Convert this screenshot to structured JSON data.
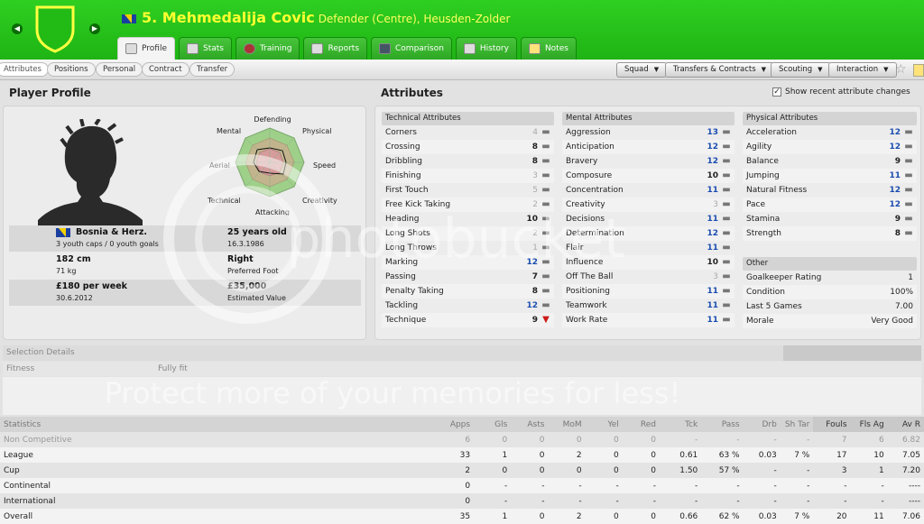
{
  "header": {
    "number": "5.",
    "name": "Mehmedalija Covic",
    "subtitle": "Defender (Centre), Heusden-Zolder",
    "colors": {
      "bar": "#2fcf21",
      "title": "#ffff30"
    },
    "prev_icon": "chevron-left-icon",
    "next_icon": "chevron-right-icon",
    "tabs": [
      {
        "label": "Profile",
        "active": true,
        "icon": "profile-icon"
      },
      {
        "label": "Stats",
        "icon": "stats-icon"
      },
      {
        "label": "Training",
        "icon": "training-icon"
      },
      {
        "label": "Reports",
        "icon": "reports-icon"
      },
      {
        "label": "Comparison",
        "icon": "comparison-icon"
      },
      {
        "label": "History",
        "icon": "history-icon"
      },
      {
        "label": "Notes",
        "icon": "notes-icon"
      }
    ]
  },
  "subbar": {
    "tabs": [
      "Attributes",
      "Positions",
      "Personal",
      "Contract",
      "Transfer"
    ],
    "menus": [
      "Squad",
      "Transfers & Contracts",
      "Scouting",
      "Interaction"
    ]
  },
  "profile": {
    "heading": "Player Profile",
    "radar_labels": [
      "Defending",
      "Physical",
      "Speed",
      "Creativity",
      "Attacking",
      "Technical",
      "Aerial",
      "Mental"
    ],
    "nationality": "Bosnia & Herz.",
    "caps": "3 youth caps / 0 youth goals",
    "age": "25 years old",
    "dob": "16.3.1986",
    "height": "182 cm",
    "weight": "71 kg",
    "foot": "Right",
    "foot_label": "Preferred Foot",
    "wage": "£180 per week",
    "contract": "30.6.2012",
    "value": "£35,000",
    "value_label": "Estimated Value"
  },
  "attributes": {
    "heading": "Attributes",
    "show_changes_label": "Show recent attribute changes",
    "show_changes_checked": true,
    "technical": {
      "title": "Technical Attributes",
      "rows": [
        {
          "name": "Corners",
          "value": "4",
          "style": "grey",
          "change": "none"
        },
        {
          "name": "Crossing",
          "value": "8",
          "style": "",
          "change": "none"
        },
        {
          "name": "Dribbling",
          "value": "8",
          "style": "",
          "change": "none"
        },
        {
          "name": "Finishing",
          "value": "3",
          "style": "grey",
          "change": "none"
        },
        {
          "name": "First Touch",
          "value": "5",
          "style": "grey",
          "change": "none"
        },
        {
          "name": "Free Kick Taking",
          "value": "2",
          "style": "grey",
          "change": "none"
        },
        {
          "name": "Heading",
          "value": "10",
          "style": "",
          "change": "none"
        },
        {
          "name": "Long Shots",
          "value": "2",
          "style": "grey",
          "change": "none"
        },
        {
          "name": "Long Throws",
          "value": "1",
          "style": "grey",
          "change": "none"
        },
        {
          "name": "Marking",
          "value": "12",
          "style": "blue",
          "change": "none"
        },
        {
          "name": "Passing",
          "value": "7",
          "style": "",
          "change": "none"
        },
        {
          "name": "Penalty Taking",
          "value": "8",
          "style": "",
          "change": "none"
        },
        {
          "name": "Tackling",
          "value": "12",
          "style": "blue",
          "change": "none"
        },
        {
          "name": "Technique",
          "value": "9",
          "style": "",
          "change": "down"
        }
      ]
    },
    "mental": {
      "title": "Mental Attributes",
      "rows": [
        {
          "name": "Aggression",
          "value": "13",
          "style": "blue",
          "change": "none"
        },
        {
          "name": "Anticipation",
          "value": "12",
          "style": "blue",
          "change": "none"
        },
        {
          "name": "Bravery",
          "value": "12",
          "style": "blue",
          "change": "none"
        },
        {
          "name": "Composure",
          "value": "10",
          "style": "",
          "change": "none"
        },
        {
          "name": "Concentration",
          "value": "11",
          "style": "blue",
          "change": "none"
        },
        {
          "name": "Creativity",
          "value": "3",
          "style": "grey",
          "change": "none"
        },
        {
          "name": "Decisions",
          "value": "11",
          "style": "blue",
          "change": "none"
        },
        {
          "name": "Determination",
          "value": "12",
          "style": "blue",
          "change": "none"
        },
        {
          "name": "Flair",
          "value": "11",
          "style": "blue",
          "change": "none"
        },
        {
          "name": "Influence",
          "value": "10",
          "style": "",
          "change": "none"
        },
        {
          "name": "Off The Ball",
          "value": "3",
          "style": "grey",
          "change": "none"
        },
        {
          "name": "Positioning",
          "value": "11",
          "style": "blue",
          "change": "none"
        },
        {
          "name": "Teamwork",
          "value": "11",
          "style": "blue",
          "change": "none"
        },
        {
          "name": "Work Rate",
          "value": "11",
          "style": "blue",
          "change": "none"
        }
      ]
    },
    "physical": {
      "title": "Physical Attributes",
      "rows": [
        {
          "name": "Acceleration",
          "value": "12",
          "style": "blue",
          "change": "none"
        },
        {
          "name": "Agility",
          "value": "12",
          "style": "blue",
          "change": "none"
        },
        {
          "name": "Balance",
          "value": "9",
          "style": "",
          "change": "none"
        },
        {
          "name": "Jumping",
          "value": "11",
          "style": "blue",
          "change": "none"
        },
        {
          "name": "Natural Fitness",
          "value": "12",
          "style": "blue",
          "change": "none"
        },
        {
          "name": "Pace",
          "value": "12",
          "style": "blue",
          "change": "none"
        },
        {
          "name": "Stamina",
          "value": "9",
          "style": "",
          "change": "none"
        },
        {
          "name": "Strength",
          "value": "8",
          "style": "",
          "change": "none"
        }
      ]
    },
    "other": {
      "title": "Other",
      "rows": [
        {
          "name": "Goalkeeper Rating",
          "value": "1"
        },
        {
          "name": "Condition",
          "value": "100%"
        },
        {
          "name": "Last 5 Games",
          "value": "7.00"
        },
        {
          "name": "Morale",
          "value": "Very Good"
        }
      ]
    }
  },
  "selection": {
    "title": "Selection Details",
    "label": "Fitness",
    "value": "Fully fit"
  },
  "watermark": {
    "logo": "photobucket",
    "tagline": "Protect more of your memories for less!"
  },
  "statistics": {
    "columns": [
      "Statistics",
      "Apps",
      "Gls",
      "Asts",
      "MoM",
      "Yel",
      "Red",
      "Tck",
      "Pass",
      "Drb",
      "Sh Tar",
      "Fouls",
      "Fls Ag",
      "Av R"
    ],
    "highlight_columns": [
      11,
      12,
      13
    ],
    "rows": [
      {
        "style": "grey",
        "cells": [
          "Non Competitive",
          "6",
          "0",
          "0",
          "0",
          "0",
          "0",
          "-",
          "-",
          "-",
          "-",
          "7",
          "6",
          "6.82"
        ]
      },
      {
        "style": "",
        "cells": [
          "League",
          "33",
          "1",
          "0",
          "2",
          "0",
          "0",
          "0.61",
          "63 %",
          "0.03",
          "7 %",
          "17",
          "10",
          "7.05"
        ]
      },
      {
        "style": "",
        "cells": [
          "Cup",
          "2",
          "0",
          "0",
          "0",
          "0",
          "0",
          "1.50",
          "57 %",
          "-",
          "-",
          "3",
          "1",
          "7.20"
        ]
      },
      {
        "style": "",
        "cells": [
          "Continental",
          "0",
          "-",
          "-",
          "-",
          "-",
          "-",
          "-",
          "-",
          "-",
          "-",
          "-",
          "-",
          "----"
        ]
      },
      {
        "style": "",
        "cells": [
          "International",
          "0",
          "-",
          "-",
          "-",
          "-",
          "-",
          "-",
          "-",
          "-",
          "-",
          "-",
          "-",
          "----"
        ]
      },
      {
        "style": "",
        "cells": [
          "Overall",
          "35",
          "1",
          "0",
          "2",
          "0",
          "0",
          "0.66",
          "62 %",
          "0.03",
          "7 %",
          "20",
          "11",
          "7.06"
        ]
      }
    ]
  }
}
